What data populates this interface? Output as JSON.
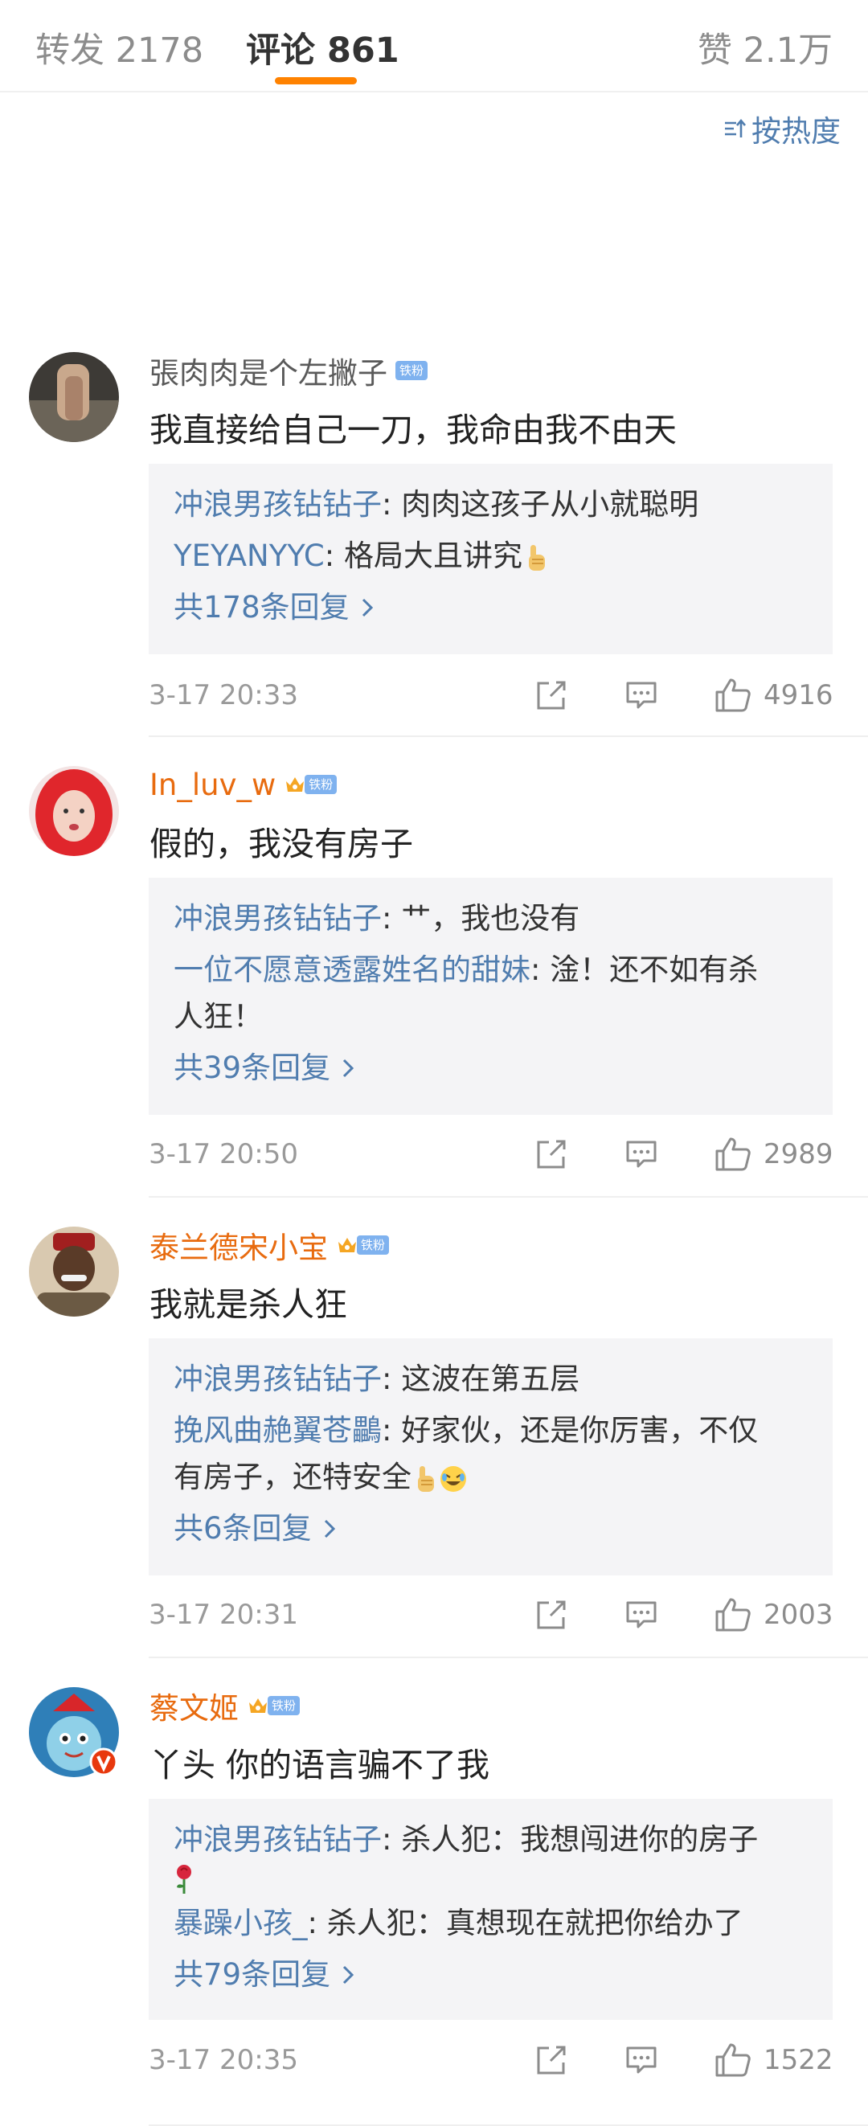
{
  "tabs": [
    {
      "label": "转发 2178"
    },
    {
      "label": "评论 861"
    },
    {
      "label": "赞 2.1万"
    }
  ],
  "sort": {
    "label": "按热度"
  },
  "colors": {
    "accent": "#ff8200",
    "link": "#507daf",
    "vip_name": "#e86b0f",
    "badge": "#7fb2ef"
  },
  "comments": [
    {
      "user": "張肉肉是个左撇子",
      "badge": "铁粉",
      "text": "我直接给自己一刀，我命由我不由天",
      "replies": [
        {
          "user": "冲浪男孩钻钻子",
          "text": ": 肉肉这孩子从小就聪明"
        },
        {
          "user": "YEYANYYC",
          "text": ": 格局大且讲究"
        }
      ],
      "more": "共178条回复",
      "time": "3-17 20:33",
      "likes": "4916"
    },
    {
      "user": "In_luv_w",
      "badge": "铁粉",
      "text": "假的，我没有房子",
      "replies": [
        {
          "user": "冲浪男孩钻钻子",
          "text": ": 艹，我也没有"
        },
        {
          "user": "一位不愿意透露姓名的甜妹",
          "text": ": 淦！还不如有杀",
          "text2": "人狂！"
        }
      ],
      "more": "共39条回复",
      "time": "3-17 20:50",
      "likes": "2989"
    },
    {
      "user": "泰兰德宋小宝",
      "badge": "铁粉",
      "text": "我就是杀人狂",
      "replies": [
        {
          "user": "冲浪男孩钻钻子",
          "text": ": 这波在第五层"
        },
        {
          "user": "挽风曲赩翼苍鸓",
          "text": ": 好家伙，还是你厉害，不仅",
          "text2": "有房子，还特安全"
        }
      ],
      "more": "共6条回复",
      "time": "3-17 20:31",
      "likes": "2003"
    },
    {
      "user": "蔡文姬",
      "badge": "铁粉",
      "text": "丫头 你的语言骗不了我",
      "replies": [
        {
          "user": "冲浪男孩钻钻子",
          "text": ": 杀人犯：我想闯进你的房子"
        },
        {
          "user": "暴躁小孩_",
          "text": ": 杀人犯：真想现在就把你给办了"
        }
      ],
      "more": "共79条回复",
      "time": "3-17 20:35",
      "likes": "1522"
    }
  ]
}
